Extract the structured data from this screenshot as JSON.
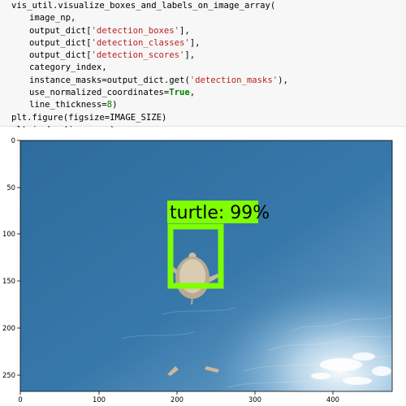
{
  "notebook": {
    "code_lines": [
      {
        "indent": 0,
        "segments": [
          {
            "text": "vis_util.visualize_boxes_and_labels_on_image_array(",
            "cls": ""
          }
        ]
      },
      {
        "indent": 1,
        "segments": [
          {
            "text": "image_np,",
            "cls": ""
          }
        ]
      },
      {
        "indent": 1,
        "segments": [
          {
            "text": "output_dict[",
            "cls": ""
          },
          {
            "text": "'detection_boxes'",
            "cls": "str"
          },
          {
            "text": "],",
            "cls": ""
          }
        ]
      },
      {
        "indent": 1,
        "segments": [
          {
            "text": "output_dict[",
            "cls": ""
          },
          {
            "text": "'detection_classes'",
            "cls": "str"
          },
          {
            "text": "],",
            "cls": ""
          }
        ]
      },
      {
        "indent": 1,
        "segments": [
          {
            "text": "output_dict[",
            "cls": ""
          },
          {
            "text": "'detection_scores'",
            "cls": "str"
          },
          {
            "text": "],",
            "cls": ""
          }
        ]
      },
      {
        "indent": 1,
        "segments": [
          {
            "text": "category_index,",
            "cls": ""
          }
        ]
      },
      {
        "indent": 1,
        "segments": [
          {
            "text": "instance_masks=output_dict.get(",
            "cls": ""
          },
          {
            "text": "'detection_masks'",
            "cls": "str"
          },
          {
            "text": "),",
            "cls": ""
          }
        ]
      },
      {
        "indent": 1,
        "segments": [
          {
            "text": "use_normalized_coordinates=",
            "cls": ""
          },
          {
            "text": "True",
            "cls": "kw"
          },
          {
            "text": ",",
            "cls": ""
          }
        ]
      },
      {
        "indent": 1,
        "segments": [
          {
            "text": "line_thickness=",
            "cls": ""
          },
          {
            "text": "8",
            "cls": "num"
          },
          {
            "text": ")",
            "cls": ""
          }
        ]
      },
      {
        "indent": 0,
        "segments": [
          {
            "text": "plt.figure(figsize=IMAGE_SIZE)",
            "cls": ""
          }
        ]
      },
      {
        "indent": 0,
        "segments": [
          {
            "text": "plt.imshow(image_np)",
            "cls": ""
          }
        ]
      }
    ]
  },
  "figure": {
    "x_ticks": [
      "0",
      "100",
      "200",
      "300",
      "400"
    ],
    "y_ticks": [
      "0",
      "50",
      "100",
      "150",
      "200",
      "250"
    ],
    "detection": {
      "label": "turtle: 99%",
      "class_name": "turtle",
      "score_percent": 99
    },
    "colors": {
      "box": "#7fff00",
      "water_deep": "#2f6d9c",
      "water_light": "#5d9fcf",
      "text": "#000000",
      "code_bg": "#f7f7f7",
      "string": "#ba2121",
      "keyword": "#008000"
    }
  }
}
